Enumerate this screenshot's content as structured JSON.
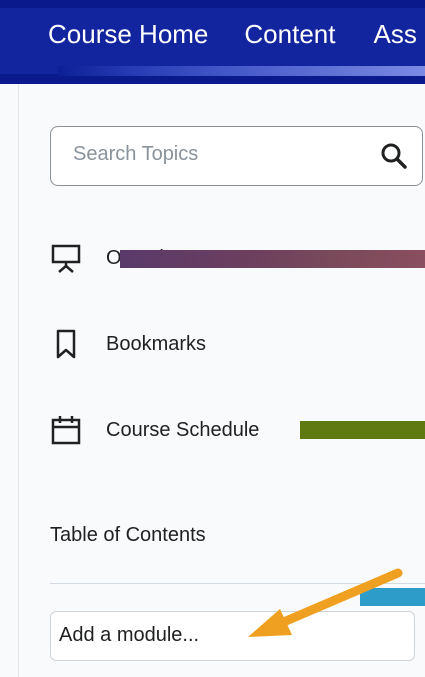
{
  "nav": {
    "items": [
      {
        "label": "Course Home"
      },
      {
        "label": "Content"
      },
      {
        "label": "Ass"
      }
    ]
  },
  "search": {
    "placeholder": "Search Topics"
  },
  "menu": {
    "items": [
      {
        "label": "Overview",
        "icon": "presentation-icon"
      },
      {
        "label": "Bookmarks",
        "icon": "bookmark-icon"
      },
      {
        "label": "Course Schedule",
        "icon": "calendar-icon"
      }
    ]
  },
  "toc": {
    "heading": "Table of Contents"
  },
  "add_module": {
    "placeholder": "Add a module..."
  },
  "colors": {
    "nav_bg": "#0a1a8c",
    "arrow": "#f0a020",
    "page_bg": "#f9fafb"
  }
}
